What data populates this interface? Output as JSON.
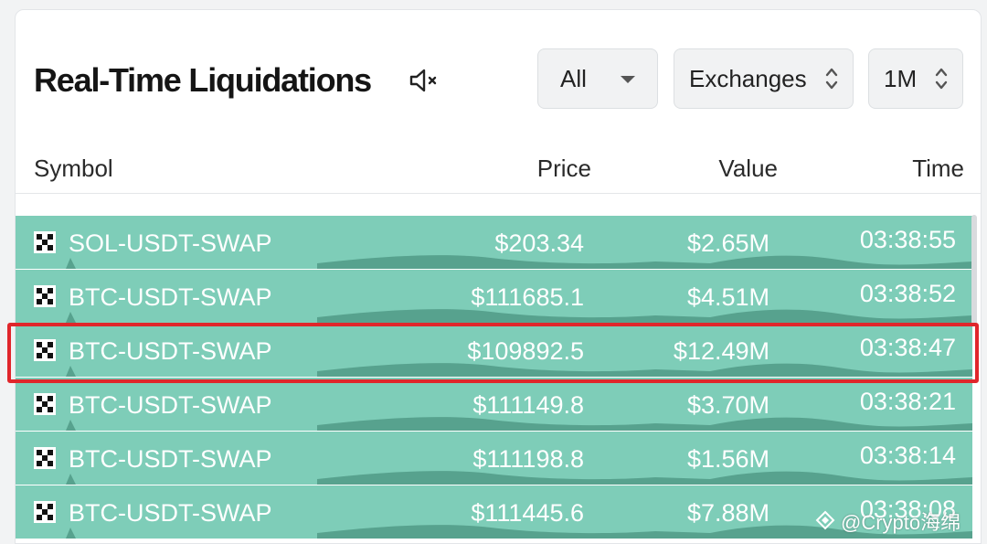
{
  "header": {
    "title": "Real-Time Liquidations",
    "mute_icon": "speaker-muted-icon"
  },
  "controls": {
    "filter_label": "All",
    "exchanges_label": "Exchanges",
    "timeframe_label": "1M"
  },
  "table": {
    "columns": [
      "Symbol",
      "Price",
      "Value",
      "Time"
    ],
    "rows": [
      {
        "symbol": "SOL-USDT-SWAP",
        "price": "$203.34",
        "value": "$2.65M",
        "time": "03:38:55"
      },
      {
        "symbol": "BTC-USDT-SWAP",
        "price": "$111685.1",
        "value": "$4.51M",
        "time": "03:38:52"
      },
      {
        "symbol": "BTC-USDT-SWAP",
        "price": "$109892.5",
        "value": "$12.49M",
        "time": "03:38:47"
      },
      {
        "symbol": "BTC-USDT-SWAP",
        "price": "$111149.8",
        "value": "$3.70M",
        "time": "03:38:21"
      },
      {
        "symbol": "BTC-USDT-SWAP",
        "price": "$111198.8",
        "value": "$1.56M",
        "time": "03:38:14"
      },
      {
        "symbol": "BTC-USDT-SWAP",
        "price": "$111445.6",
        "value": "$7.88M",
        "time": "03:38:08"
      }
    ],
    "row_color": "#7ecdb8",
    "highlight_color": "#e0262b",
    "exchange_icon": "okx-exchange-icon"
  },
  "watermark": {
    "text": "@Crypto海绵"
  }
}
